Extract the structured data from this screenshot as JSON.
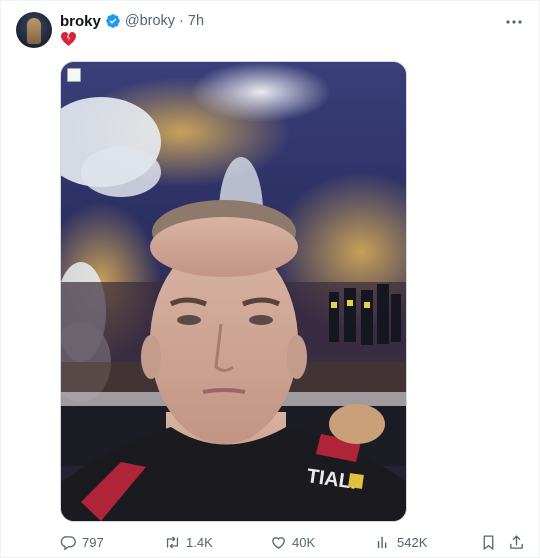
{
  "author": {
    "name": "broky",
    "handle": "@broky",
    "separator": "·",
    "time": "7h"
  },
  "tweet": {
    "text_emoji": "broken-heart-emoji"
  },
  "media": {
    "has_alt_indicator": true
  },
  "actions": {
    "replies": "797",
    "reposts": "1.4K",
    "likes": "40K",
    "views": "542K"
  },
  "colors": {
    "text_primary": "#0f1419",
    "text_secondary": "#536471",
    "verified_blue": "#1d9bf0",
    "broken_heart_red": "#d8243a",
    "border": "#cfd9de"
  },
  "icons": [
    "verified-badge-icon",
    "more-options-icon",
    "reply-icon",
    "repost-icon",
    "like-icon",
    "views-icon",
    "bookmark-icon",
    "share-icon"
  ]
}
